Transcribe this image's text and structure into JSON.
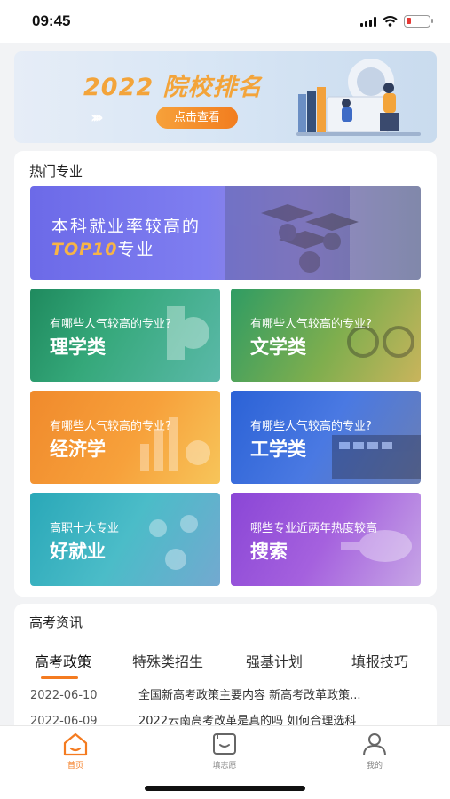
{
  "status_bar": {
    "time": "09:45"
  },
  "banner": {
    "title": "2022 院校排名",
    "button": "点击查看"
  },
  "hot_majors": {
    "title": "热门专业",
    "top_tile": {
      "line1": "本科就业率较高的",
      "highlight": "TOP10",
      "suffix": "专业"
    },
    "tiles": [
      {
        "sub": "有哪些人气较高的专业?",
        "main": "理学类"
      },
      {
        "sub": "有哪些人气较高的专业?",
        "main": "文学类"
      },
      {
        "sub": "有哪些人气较高的专业?",
        "main": "经济学"
      },
      {
        "sub": "有哪些人气较高的专业?",
        "main": "工学类"
      },
      {
        "sub": "高职十大专业",
        "main": "好就业"
      },
      {
        "sub": "哪些专业近两年热度较高",
        "main": "搜索"
      }
    ]
  },
  "news": {
    "title": "高考资讯",
    "tabs": [
      "高考政策",
      "特殊类招生",
      "强基计划",
      "填报技巧"
    ],
    "items": [
      {
        "date": "2022-06-10",
        "headline": "全国新高考政策主要内容 新高考改革政策..."
      },
      {
        "date": "2022-06-09",
        "headline": "2022云南高考改革是真的吗 如何合理选科"
      }
    ]
  },
  "tabbar": {
    "items": [
      {
        "label": "首页",
        "icon": "home-icon",
        "active": true
      },
      {
        "label": "填志愿",
        "icon": "fill-form-icon",
        "active": false
      },
      {
        "label": "我的",
        "icon": "user-icon",
        "active": false
      }
    ]
  },
  "colors": {
    "accent": "#f47b20",
    "banner_title": "#f3a43a"
  }
}
